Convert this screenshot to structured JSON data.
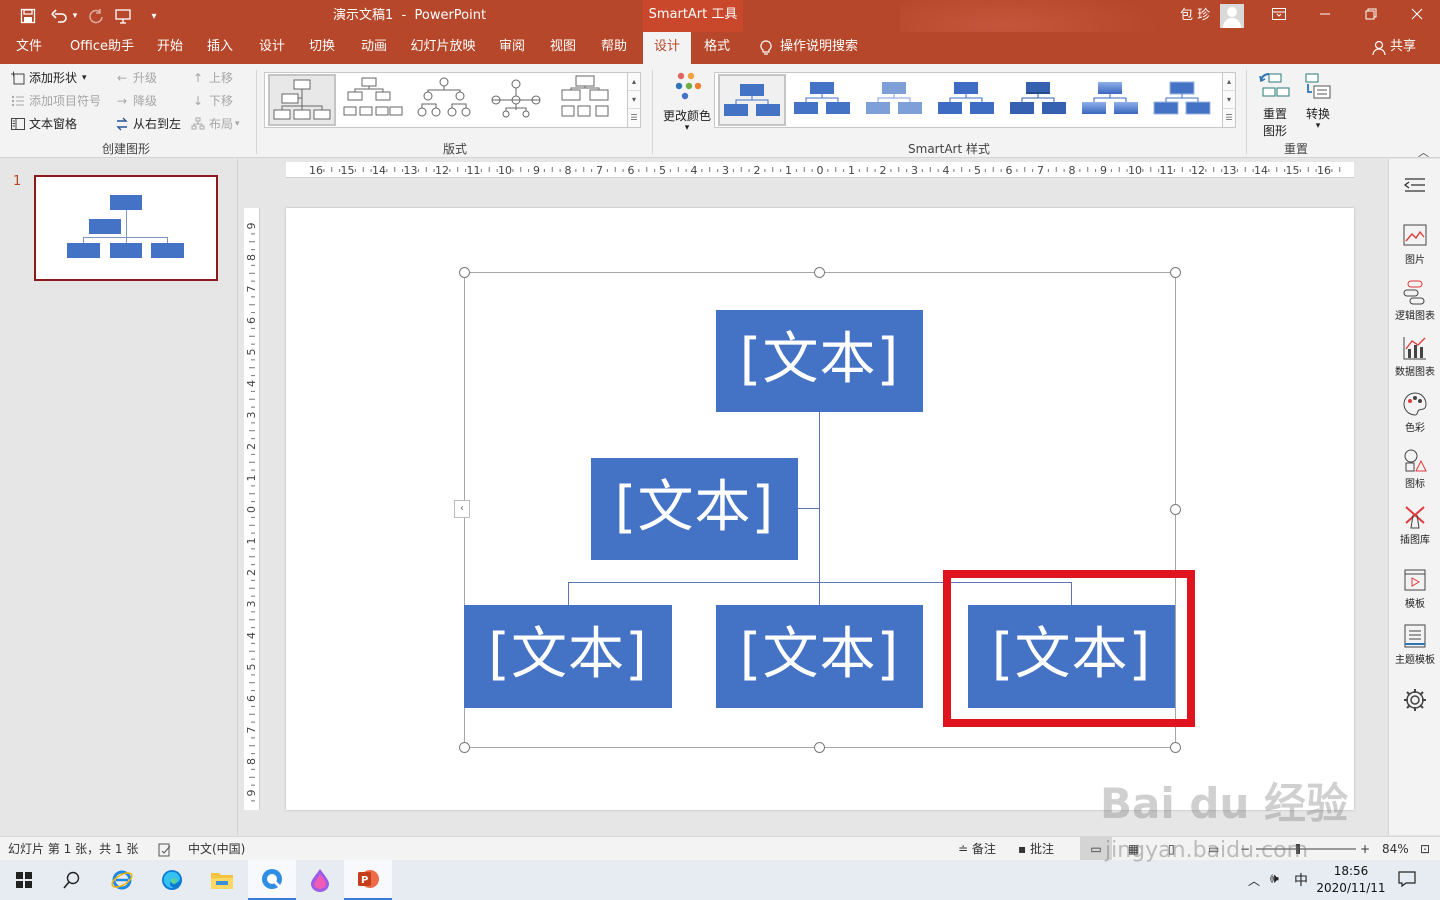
{
  "titlebar": {
    "doc_title": "演示文稿1  -  PowerPoint",
    "tool_context": "SmartArt 工具",
    "user": "包 珍",
    "colors": {
      "brand": "#b7472a"
    }
  },
  "tabs": [
    {
      "label": "文件"
    },
    {
      "label": "Office助手"
    },
    {
      "label": "开始"
    },
    {
      "label": "插入"
    },
    {
      "label": "设计"
    },
    {
      "label": "切换"
    },
    {
      "label": "动画"
    },
    {
      "label": "幻灯片放映"
    },
    {
      "label": "审阅"
    },
    {
      "label": "视图"
    },
    {
      "label": "帮助"
    },
    {
      "label": "设计",
      "active": true
    },
    {
      "label": "格式"
    }
  ],
  "tell_me": "操作说明搜索",
  "share": "共享",
  "ribbon": {
    "create_graphic": {
      "add_shape": "添加形状",
      "add_bullet": "添加项目符号",
      "text_pane": "文本窗格",
      "promote": "升级",
      "demote": "降级",
      "right_to_left": "从右到左",
      "move_up": "上移",
      "move_down": "下移",
      "layout": "布局",
      "label": "创建图形"
    },
    "layouts_label": "版式",
    "change_colors": "更改颜色",
    "styles_label": "SmartArt 样式",
    "reset_graphic": "重置图形",
    "reset_graphic_line1": "重置",
    "reset_graphic_line2": "图形",
    "convert": "转换",
    "reset_label": "重置"
  },
  "thumbnails": {
    "slide_number": "1"
  },
  "slide": {
    "nodes": [
      "[文本]",
      "[文本]",
      "[文本]",
      "[文本]",
      "[文本]"
    ]
  },
  "ruler": {
    "h": [
      "16",
      "15",
      "14",
      "13",
      "12",
      "11",
      "10",
      "9",
      "8",
      "7",
      "6",
      "5",
      "4",
      "3",
      "2",
      "1",
      "0",
      "1",
      "2",
      "3",
      "4",
      "5",
      "6",
      "7",
      "8",
      "9",
      "10",
      "11",
      "12",
      "13",
      "14",
      "15",
      "16"
    ],
    "v": [
      "9",
      "8",
      "7",
      "6",
      "5",
      "4",
      "3",
      "2",
      "1",
      "0",
      "1",
      "2",
      "3",
      "4",
      "5",
      "6",
      "7",
      "8",
      "9"
    ]
  },
  "right_panel": [
    {
      "label": "图片"
    },
    {
      "label": "逻辑图表"
    },
    {
      "label": "数据图表"
    },
    {
      "label": "色彩"
    },
    {
      "label": "图标"
    },
    {
      "label": "插图库"
    },
    {
      "label": "模板"
    },
    {
      "label": "主题模板"
    }
  ],
  "statusbar": {
    "slide_info": "幻灯片 第 1 张，共 1 张",
    "language": "中文(中国)",
    "notes": "备注",
    "comments": "批注",
    "zoom": "84%"
  },
  "taskbar": {
    "time": "18:56",
    "date": "2020/11/11",
    "ime": "中"
  },
  "watermark": {
    "main": "Bai du 经验",
    "url": "jingyan.baidu.com"
  }
}
